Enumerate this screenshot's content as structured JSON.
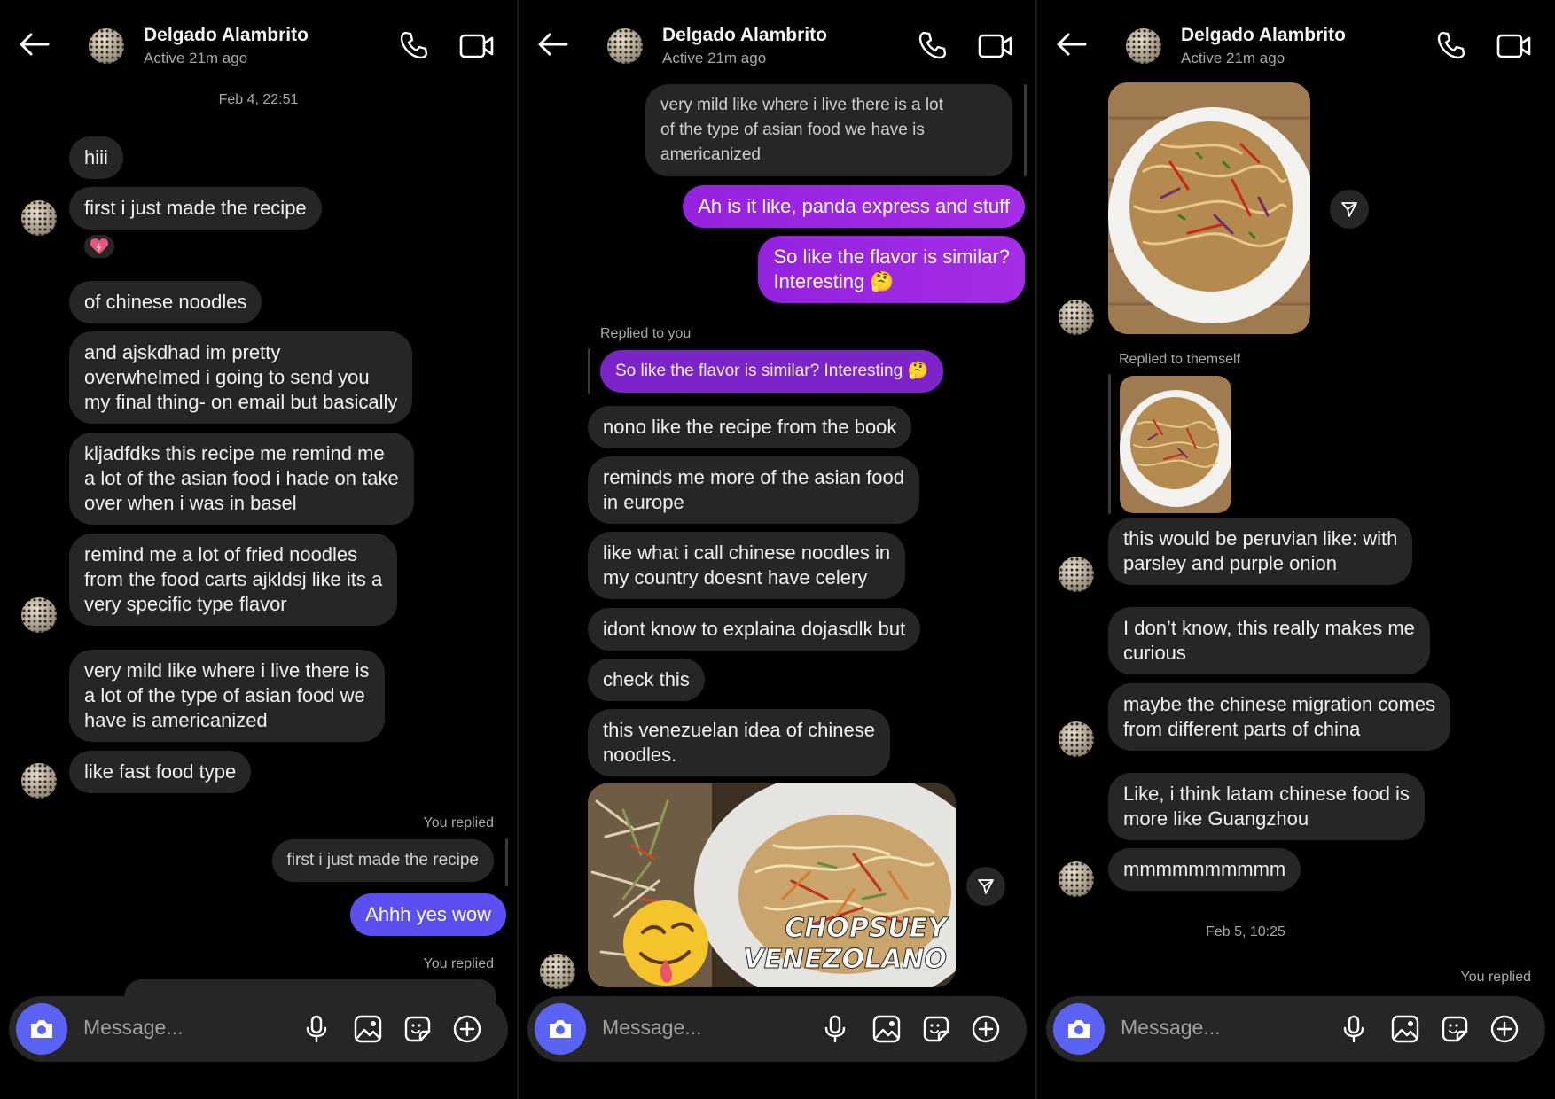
{
  "contact": {
    "name": "Delgado Alambrito",
    "status": "Active 21m ago"
  },
  "composer": {
    "placeholder": "Message..."
  },
  "icons": [
    "back-arrow-icon",
    "phone-icon",
    "video-icon",
    "camera-icon",
    "microphone-icon",
    "gallery-icon",
    "sticker-icon",
    "plus-icon",
    "share-icon"
  ],
  "colors": {
    "incoming_bubble": "#262626",
    "outgoing_bubble": "#9422df",
    "blue_bubble": "#5b4ff2",
    "camera_button": "#5b63f5"
  },
  "panel1": {
    "timestamp": "Feb 4, 22:51",
    "msgs": [
      "hiii",
      "first i just made the recipe",
      "of chinese noodles",
      "and ajskdhad im pretty\noverwhelmed i going to send you\nmy final thing- on email but basically",
      "kljadfdks this recipe me remind me\na lot of the asian food i hade on take\nover when i was in basel",
      "remind me a lot of fried noodles\nfrom the food carts ajkldsj like its a\nvery specific type flavor",
      "very mild like where i live there is\na lot of the type of asian food we\nhave is americanized",
      "like fast food type"
    ],
    "you_replied_1": "You replied",
    "quoted_1": "first i just made the recipe",
    "reply_1": "Ahhh yes wow",
    "you_replied_2": "You replied"
  },
  "panel2": {
    "msgs": [
      "very mild like where i live there is a lot\nof the type of asian food we have is\namericanized",
      "Ah is it like, panda express and stuff",
      "So like the flavor is similar?\nInteresting 🤔",
      "nono like the recipe from the book",
      "reminds me more of the asian  food\nin europe",
      "like what i call chinese noodles in\nmy country doesnt have celery",
      "idont know to explaina dojasdlk but",
      "check this",
      "this venezuelan idea of chinese\nnoodles."
    ],
    "replied_to_you": "Replied to you",
    "quoted": "So like the flavor is similar? Interesting 🤔",
    "image_caption_1": "CHOPSUEY",
    "image_caption_2": "VENEZOLANO"
  },
  "panel3": {
    "replied_to_themself": "Replied to themself",
    "msgs": [
      "this would be peruvian like: with\nparsley and purple onion",
      "I don’t know, this really makes me\ncurious",
      "maybe the chinese migration comes\nfrom different parts of china",
      "Like,  i think latam chinese food is\nmore like  Guangzhou",
      "mmmmmmmmmm"
    ],
    "timestamp": "Feb 5, 10:25",
    "you_replied": "You replied"
  }
}
